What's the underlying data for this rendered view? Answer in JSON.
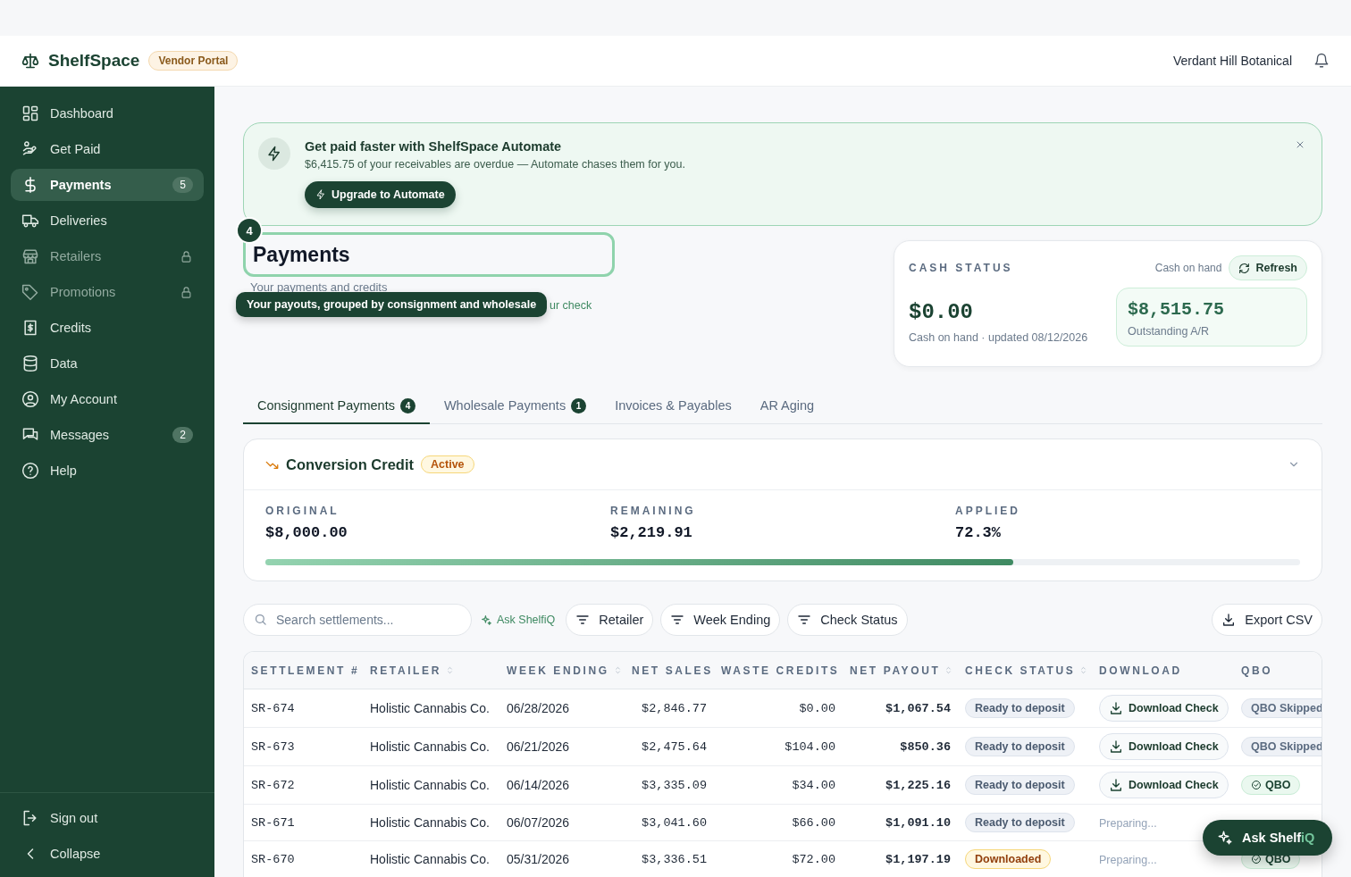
{
  "header": {
    "brand": "ShelfSpace",
    "badge": "Vendor Portal",
    "account": "Verdant Hill Botanical"
  },
  "sidebar": {
    "items": [
      {
        "label": "Dashboard",
        "selected": false,
        "locked": false
      },
      {
        "label": "Get Paid",
        "selected": false,
        "locked": false
      },
      {
        "label": "Payments",
        "selected": true,
        "locked": false,
        "count": "5"
      },
      {
        "label": "Deliveries",
        "selected": false,
        "locked": false
      },
      {
        "label": "Retailers",
        "selected": false,
        "locked": true
      },
      {
        "label": "Promotions",
        "selected": false,
        "locked": true
      },
      {
        "label": "Credits",
        "selected": false,
        "locked": false
      },
      {
        "label": "Data",
        "selected": false,
        "locked": false
      },
      {
        "label": "My Account",
        "selected": false,
        "locked": false
      },
      {
        "label": "Messages",
        "selected": false,
        "locked": false,
        "count": "2"
      },
      {
        "label": "Help",
        "selected": false,
        "locked": false
      }
    ],
    "footer": [
      "Sign out",
      "Collapse"
    ]
  },
  "banner": {
    "title": "Get paid faster with ShelfSpace Automate",
    "text": "$6,415.75 of your receivables are overdue — Automate chases them for you.",
    "button": "Upgrade to Automate"
  },
  "page": {
    "title": "Payments",
    "subtitle": "Your payments and credits",
    "hint": "ur check"
  },
  "tour": {
    "step": "4",
    "tooltip": "Your payouts, grouped by consignment and wholesale"
  },
  "cash": {
    "heading": "CASH STATUS",
    "toggle_label": "Cash on hand",
    "refresh": "Refresh",
    "amount": "$0.00",
    "caption": "Cash on hand · updated 08/12/2026",
    "ar_amount": "$8,515.75",
    "ar_label": "Outstanding A/R"
  },
  "tabs": [
    {
      "label": "Consignment Payments",
      "count": "4",
      "selected": true
    },
    {
      "label": "Wholesale Payments",
      "count": "1",
      "selected": false
    },
    {
      "label": "Invoices & Payables",
      "selected": false
    },
    {
      "label": "AR Aging",
      "selected": false
    }
  ],
  "credit": {
    "title": "Conversion Credit",
    "status": "Active",
    "expanded": true,
    "stats": [
      {
        "label": "ORIGINAL",
        "value": "$8,000.00"
      },
      {
        "label": "REMAINING",
        "value": "$2,219.91"
      },
      {
        "label": "APPLIED",
        "value": "72.3%"
      }
    ],
    "level": 0.723
  },
  "toolbar": {
    "search": {
      "placeholder": "Search settlements..."
    },
    "ask": "Ask ShelfiQ",
    "filters": [
      "Retailer",
      "Week Ending",
      "Check Status"
    ],
    "export": "Export CSV"
  },
  "table": {
    "columns": [
      {
        "label": "SETTLEMENT #",
        "sortable": false
      },
      {
        "label": "RETAILER",
        "sortable": true
      },
      {
        "label": "WEEK ENDING",
        "sortable": true
      },
      {
        "label": "NET SALES",
        "sortable": false
      },
      {
        "label": "WASTE CREDITS",
        "sortable": false
      },
      {
        "label": "NET PAYOUT",
        "sortable": true
      },
      {
        "label": "CHECK STATUS",
        "sortable": true
      },
      {
        "label": "DOWNLOAD",
        "sortable": false
      },
      {
        "label": "QBO",
        "sortable": false
      }
    ],
    "rows": [
      {
        "settlement": "SR-674",
        "retailer": "Holistic Cannabis Co.",
        "week_ending": "06/28/2026",
        "net_sales": "$2,846.77",
        "waste_credits": "$0.00",
        "net_payout": "$1,067.54",
        "check_status": {
          "kind": "ready",
          "label": "Ready to deposit"
        },
        "download": {
          "kind": "button",
          "label": "Download Check"
        },
        "qbo": {
          "kind": "skipped",
          "label": "QBO Skipped"
        }
      },
      {
        "settlement": "SR-673",
        "retailer": "Holistic Cannabis Co.",
        "week_ending": "06/21/2026",
        "net_sales": "$2,475.64",
        "waste_credits": "$104.00",
        "net_payout": "$850.36",
        "check_status": {
          "kind": "ready",
          "label": "Ready to deposit"
        },
        "download": {
          "kind": "button",
          "label": "Download Check"
        },
        "qbo": {
          "kind": "skipped",
          "label": "QBO Skipped"
        }
      },
      {
        "settlement": "SR-672",
        "retailer": "Holistic Cannabis Co.",
        "week_ending": "06/14/2026",
        "net_sales": "$3,335.09",
        "waste_credits": "$34.00",
        "net_payout": "$1,225.16",
        "check_status": {
          "kind": "ready",
          "label": "Ready to deposit"
        },
        "download": {
          "kind": "button",
          "label": "Download Check"
        },
        "qbo": {
          "kind": "synced",
          "label": "QBO"
        }
      },
      {
        "settlement": "SR-671",
        "retailer": "Holistic Cannabis Co.",
        "week_ending": "06/07/2026",
        "net_sales": "$3,041.60",
        "waste_credits": "$66.00",
        "net_payout": "$1,091.10",
        "check_status": {
          "kind": "ready",
          "label": "Ready to deposit"
        },
        "download": {
          "kind": "preparing",
          "label": "Preparing..."
        }
      },
      {
        "settlement": "SR-670",
        "retailer": "Holistic Cannabis Co.",
        "week_ending": "05/31/2026",
        "net_sales": "$3,336.51",
        "waste_credits": "$72.00",
        "net_payout": "$1,197.19",
        "check_status": {
          "kind": "downloaded",
          "label": "Downloaded"
        },
        "download": {
          "kind": "preparing",
          "label": "Preparing..."
        },
        "qbo": {
          "kind": "synced",
          "label": "QBO"
        }
      }
    ]
  },
  "fab": {
    "label": "Ask Shelf",
    "accent": "iQ"
  }
}
